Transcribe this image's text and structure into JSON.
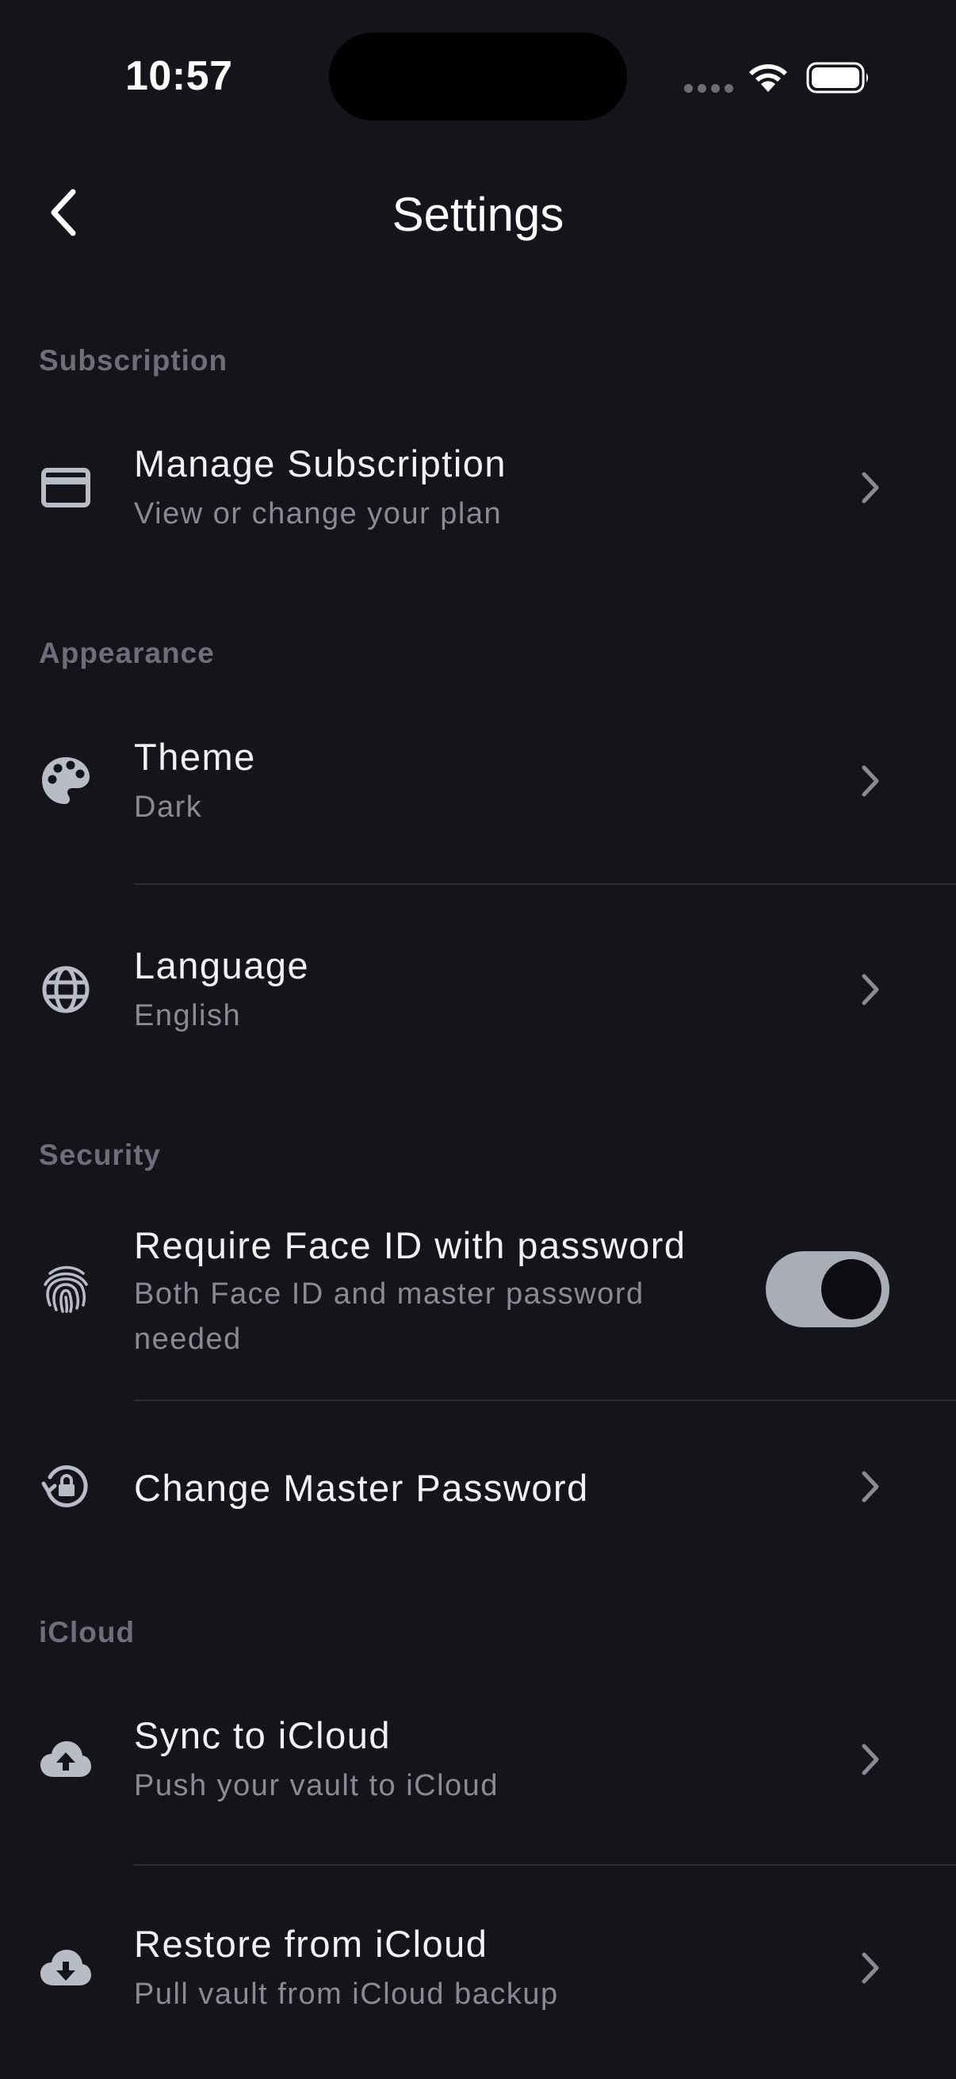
{
  "status_bar": {
    "time": "10:57"
  },
  "nav": {
    "title": "Settings"
  },
  "sections": {
    "subscription": {
      "header": "Subscription",
      "manage": {
        "label": "Manage Subscription",
        "sub": "View or change your plan",
        "icon": "credit-card-icon"
      }
    },
    "appearance": {
      "header": "Appearance",
      "theme": {
        "label": "Theme",
        "sub": "Dark",
        "icon": "palette-icon"
      },
      "language": {
        "label": "Language",
        "sub": "English",
        "icon": "globe-icon"
      }
    },
    "security": {
      "header": "Security",
      "faceid": {
        "label": "Require Face ID with password",
        "sub": "Both Face ID and master password needed",
        "icon": "fingerprint-icon",
        "enabled": true
      },
      "change_password": {
        "label": "Change Master Password",
        "icon": "lock-reset-icon"
      }
    },
    "icloud": {
      "header": "iCloud",
      "sync": {
        "label": "Sync to iCloud",
        "sub": "Push your vault to iCloud",
        "icon": "cloud-upload-icon"
      },
      "restore": {
        "label": "Restore from iCloud",
        "sub": "Pull vault from iCloud backup",
        "icon": "cloud-download-icon"
      }
    }
  },
  "colors": {
    "background": "#14141b",
    "toggle_on": "#a9adb6",
    "secondary_text": "#8a8a93",
    "section_header": "#6e6e78"
  }
}
